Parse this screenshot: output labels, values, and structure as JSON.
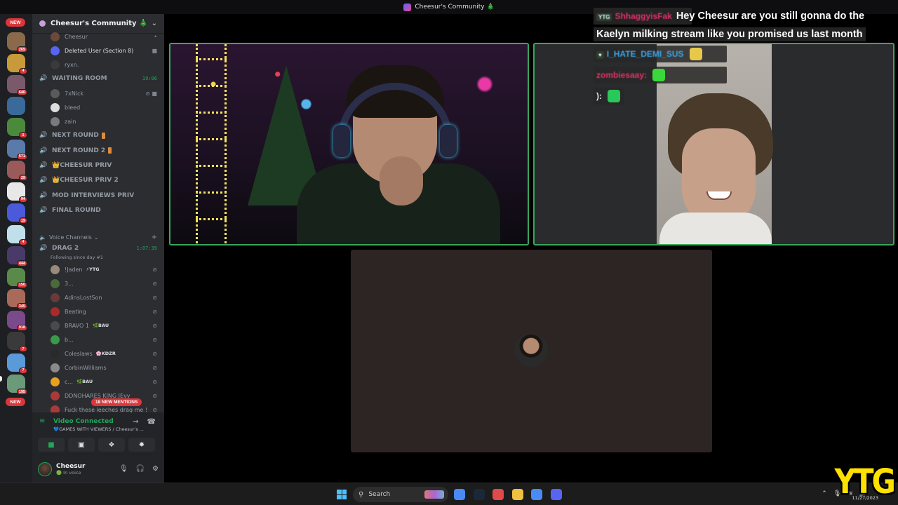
{
  "window": {
    "title": "Cheesur's Community 🎄"
  },
  "rail": {
    "new_label_top": "NEW",
    "new_label_bottom": "NEW",
    "servers": [
      {
        "badge": "269",
        "color": "#8a6a4a"
      },
      {
        "badge": "4",
        "color": "#c89a3a"
      },
      {
        "badge": "640",
        "color": "#7a5a6a"
      },
      {
        "badge": "",
        "color": "#3a6a9a"
      },
      {
        "badge": "1",
        "color": "#4a8a3a"
      },
      {
        "badge": "571",
        "color": "#5a7aaa"
      },
      {
        "badge": "29",
        "color": "#9a5a5a"
      },
      {
        "badge": "94",
        "color": "#e8e8e8"
      },
      {
        "badge": "19",
        "color": "#4a5ad8"
      },
      {
        "badge": "4",
        "color": "#bfe0ea"
      },
      {
        "badge": "444",
        "color": "#4a3a6a"
      },
      {
        "badge": "150",
        "color": "#5a8a4a"
      },
      {
        "badge": "345",
        "color": "#aa6a5a"
      },
      {
        "badge": "918",
        "color": "#7a4a8a"
      },
      {
        "badge": "7",
        "color": "#3a3a3a"
      },
      {
        "badge": "7",
        "color": "#5a9ad8"
      },
      {
        "badge": "195",
        "color": "#6a9a7a"
      }
    ]
  },
  "server": {
    "name": "Cheesur's Community 🎄"
  },
  "channels_top": [
    {
      "type": "user",
      "name": "Cheesur",
      "avatar": "#6b4a3a",
      "status": "•"
    },
    {
      "type": "user",
      "name": "Deleted User (Section 8)",
      "avatar": "#5865f2",
      "status": "■",
      "bright": true
    },
    {
      "type": "user",
      "name": "ryxn.",
      "avatar": "#3a3a3a",
      "status": ""
    },
    {
      "type": "channel",
      "name": "WAITING ROOM",
      "timer": "19:06"
    },
    {
      "type": "user",
      "name": "7xNick",
      "avatar": "#5a5a5a",
      "status": "⊘ ■"
    },
    {
      "type": "user",
      "name": "bleed",
      "avatar": "#dddddd",
      "status": ""
    },
    {
      "type": "user",
      "name": "zain",
      "avatar": "#7a7a7a",
      "status": ""
    },
    {
      "type": "channel",
      "name": "NEXT ROUND",
      "emoji": true
    },
    {
      "type": "channel",
      "name": "NEXT ROUND 2",
      "emoji": true
    },
    {
      "type": "channel",
      "name": "👑CHEESUR PRIV"
    },
    {
      "type": "channel",
      "name": "👑CHEESUR PRIV 2"
    },
    {
      "type": "channel",
      "name": "MOD INTERVIEWS PRIV"
    },
    {
      "type": "channel",
      "name": "FINAL ROUND"
    }
  ],
  "voice_section": {
    "label": "Voice Channels",
    "add": "+"
  },
  "drag_channel": {
    "name": "DRAG 2",
    "timer": "1:07:39",
    "subtitle": "Following since day #1"
  },
  "drag_users": [
    {
      "name": "!Jaden",
      "tag": "⚡YTG",
      "avatar": "#9a8a7a"
    },
    {
      "name": "3...",
      "tag": "",
      "avatar": "#4a6a3a"
    },
    {
      "name": "AdinsLostSon",
      "tag": "",
      "avatar": "#6a3a3a"
    },
    {
      "name": "Beating",
      "tag": "",
      "avatar": "#aa2a2a"
    },
    {
      "name": "BRAVO 1",
      "tag": "🌿BAU",
      "avatar": "#4a4a4a"
    },
    {
      "name": "b...",
      "tag": "",
      "avatar": "#3a9a4a"
    },
    {
      "name": "Coleslaws",
      "tag": "🌸KDZR",
      "avatar": "#2a2a2a"
    },
    {
      "name": "CorbinWilliams",
      "tag": "",
      "avatar": "#8a8a8a"
    },
    {
      "name": "c...",
      "tag": "🌿BAU",
      "avatar": "#e8a020"
    },
    {
      "name": "DDNOHARES KING JEvy",
      "tag": "",
      "avatar": "#aa3a3a"
    },
    {
      "name": "Fuck these leeches drag me !",
      "tag": "",
      "avatar": "#aa3a3a"
    }
  ],
  "mentions": "18 NEW MENTIONS",
  "voice_panel": {
    "title": "Video Connected",
    "subtitle": "💙GAMES WITH VIEWERS / Cheesur's ..."
  },
  "user": {
    "name": "Cheesur",
    "status": "🟢 In voice"
  },
  "chat": [
    {
      "badge": "YTG",
      "name": "ShhaggyisFak",
      "name_color": "#e0336a",
      "message": "Hey Cheesur are you still gonna do the",
      "blurred": true
    },
    {
      "badge": "",
      "name": "",
      "name_color": "",
      "message": "Kaelyn milking stream like you promised us last month"
    },
    {
      "badge": "♥",
      "name": "I_HATE_DEMI_SUS",
      "name_color": "#3aa6e8",
      "message": "",
      "emote": "#e8c84a",
      "blurred": true
    },
    {
      "badge": "",
      "name": "zombiesaay:",
      "name_color": "#e0336a",
      "message": "",
      "emote": "#3ad83a",
      "blurred": true
    },
    {
      "badge": "",
      "name": "):",
      "name_color": "#e8e8e8",
      "message": "",
      "emote": "#2ac85a"
    }
  ],
  "taskbar": {
    "search_placeholder": "Search",
    "date": "11/27/2023",
    "apps": [
      {
        "name": "chrome",
        "color": "#4a8af4"
      },
      {
        "name": "steam",
        "color": "#1b2838"
      },
      {
        "name": "app-red",
        "color": "#e04a4a"
      },
      {
        "name": "file-explorer",
        "color": "#f0c040"
      },
      {
        "name": "chrome-2",
        "color": "#4a8af4"
      },
      {
        "name": "discord",
        "color": "#5865f2"
      }
    ]
  },
  "watermark": "YTG"
}
